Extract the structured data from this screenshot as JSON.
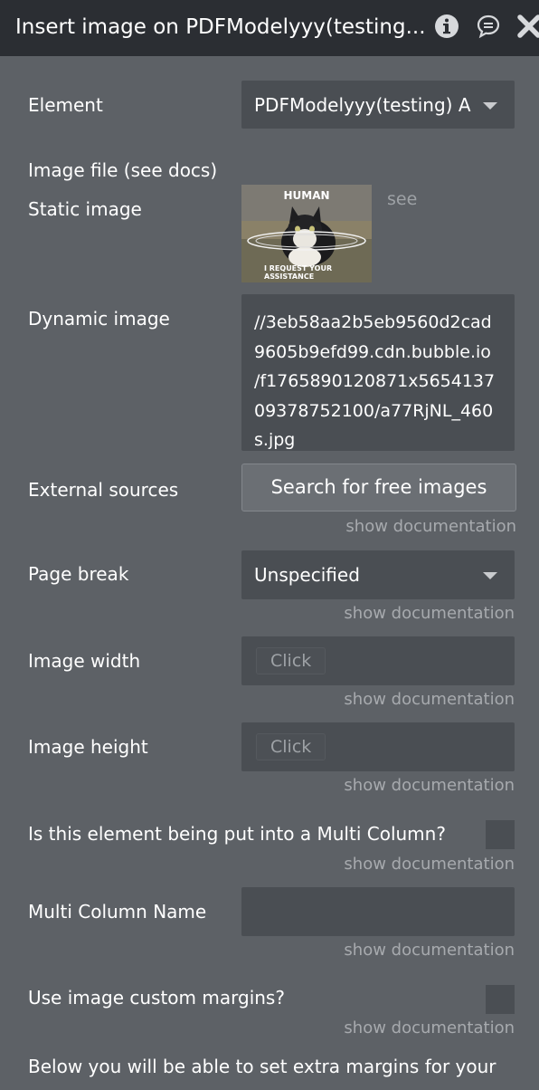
{
  "header": {
    "title": "Insert image on PDFModelyyy(testing..."
  },
  "fields": {
    "element": {
      "label": "Element",
      "value": "PDFModelyyy(testing) A"
    },
    "image_file": {
      "label": "Image file (see docs)"
    },
    "static_image": {
      "label": "Static image",
      "see_link": "see",
      "thumb_top": "HUMAN",
      "thumb_bottom": "I REQUEST YOUR\nASSISTANCE"
    },
    "dynamic_image": {
      "label": "Dynamic image",
      "value": "//3eb58aa2b5eb9560d2cad\n9605b9efd99.cdn.bubble.io\n/f1765890120871x5654137\n09378752100/a77RjNL_460\ns.jpg"
    },
    "external_sources": {
      "label": "External sources",
      "button": "Search for free images"
    },
    "page_break": {
      "label": "Page break",
      "value": "Unspecified"
    },
    "image_width": {
      "label": "Image width",
      "pill": "Click"
    },
    "image_height": {
      "label": "Image height",
      "pill": "Click"
    },
    "multi_column": {
      "label": "Is this element being put into a Multi Column?"
    },
    "multi_column_name": {
      "label": "Multi Column Name"
    },
    "custom_margins": {
      "label": "Use image custom margins?"
    },
    "margins_note": "Below you will be able to set extra margins for your"
  },
  "doc_link": "show documentation"
}
